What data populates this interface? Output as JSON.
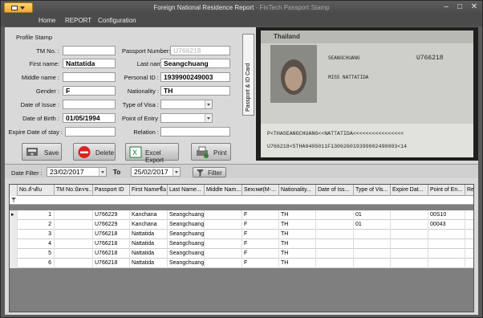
{
  "window": {
    "title": "Foreign National Residence Report",
    "subtitle": "- FinTech Passport Stamp",
    "min": "–",
    "max": "□",
    "close": "✕"
  },
  "menu": {
    "items": [
      "Home",
      "REPORT",
      "Configuration"
    ]
  },
  "form": {
    "group_title": "Profile Stamp",
    "tm_no_label": "TM No. :",
    "tm_no": "",
    "first_name_label": "First name:",
    "first_name": "Nattatida",
    "middle_name_label": "Middle name :",
    "middle_name": "",
    "gender_label": "Gender :",
    "gender": "F",
    "date_of_issue_label": "Date of Issue :",
    "date_of_issue": "",
    "dob_label": "Date of Birth :",
    "dob": "01/05/1994",
    "expire_stay_label": "Expire Date of stay :",
    "expire_stay": "",
    "passport_label": "Passport Number:",
    "passport": "U766218",
    "last_name_label": "Last name :",
    "last_name": "Seangchuang",
    "personal_id_label": "Personal ID :",
    "personal_id": "1939900249003",
    "nationality_label": "Nationality :",
    "nationality": "TH",
    "type_visa_label": "Type of Visa :",
    "type_visa": "",
    "point_entry_label": "Point of Entry :",
    "point_entry": "",
    "relation_label": "Relation :",
    "relation": ""
  },
  "buttons": {
    "save": "Save",
    "delete": "Delete",
    "excel": "Excel Export",
    "print": "Print"
  },
  "side_tab": "Passport & ID Card",
  "passport_image": {
    "country": "Thailand",
    "surname": "SEANGCHUANG",
    "given": "MISS NATTATIDA",
    "number": "U766218",
    "mrz1": "P<THASEANGCHUANG<<NATTATIDA<<<<<<<<<<<<<<<<",
    "mrz2": "U766218<5THA9405011F130626019399002490003<14"
  },
  "filter": {
    "date_filter_label": "Date Filter :",
    "from": "23/02/2017",
    "to_label": "To",
    "to": "25/02/2017",
    "filter_btn": "Filter"
  },
  "grid": {
    "columns": [
      "No.ลำดับ",
      "TM No.บัตรข...",
      "Passport ID",
      "First Nameชื่อ",
      "Last Name...",
      "Middle Nam...",
      "Sexเพศ(M-...",
      "Nationality...",
      "Date of Iss...",
      "Type of Vis...",
      "Expire Dat...",
      "Point of En...",
      "Rela"
    ],
    "rows": [
      {
        "no": "1",
        "tm": "",
        "pid": "U766229",
        "first": "Kanchana",
        "last": "Seangchuang",
        "middle": "",
        "sex": "F",
        "nat": "TH",
        "doi": "",
        "visa": "01",
        "exp": "",
        "poe": "00S10",
        "rel": ""
      },
      {
        "no": "2",
        "tm": "",
        "pid": "U766229",
        "first": "Kanchana",
        "last": "Seangchuang",
        "middle": "",
        "sex": "F",
        "nat": "TH",
        "doi": "",
        "visa": "01",
        "exp": "",
        "poe": "00043",
        "rel": ""
      },
      {
        "no": "3",
        "tm": "",
        "pid": "U766218",
        "first": "Nattatida",
        "last": "Seangchuang",
        "middle": "",
        "sex": "F",
        "nat": "TH",
        "doi": "",
        "visa": "",
        "exp": "",
        "poe": "",
        "rel": ""
      },
      {
        "no": "4",
        "tm": "",
        "pid": "U766218",
        "first": "Nattatida",
        "last": "Seangchuang",
        "middle": "",
        "sex": "F",
        "nat": "TH",
        "doi": "",
        "visa": "",
        "exp": "",
        "poe": "",
        "rel": ""
      },
      {
        "no": "5",
        "tm": "",
        "pid": "U766218",
        "first": "Nattatida",
        "last": "Seangchuang",
        "middle": "",
        "sex": "F",
        "nat": "TH",
        "doi": "",
        "visa": "",
        "exp": "",
        "poe": "",
        "rel": ""
      },
      {
        "no": "6",
        "tm": "",
        "pid": "U766218",
        "first": "Nattatida",
        "last": "Seangchuang",
        "middle": "",
        "sex": "F",
        "nat": "TH",
        "doi": "",
        "visa": "",
        "exp": "",
        "poe": "",
        "rel": ""
      }
    ]
  }
}
